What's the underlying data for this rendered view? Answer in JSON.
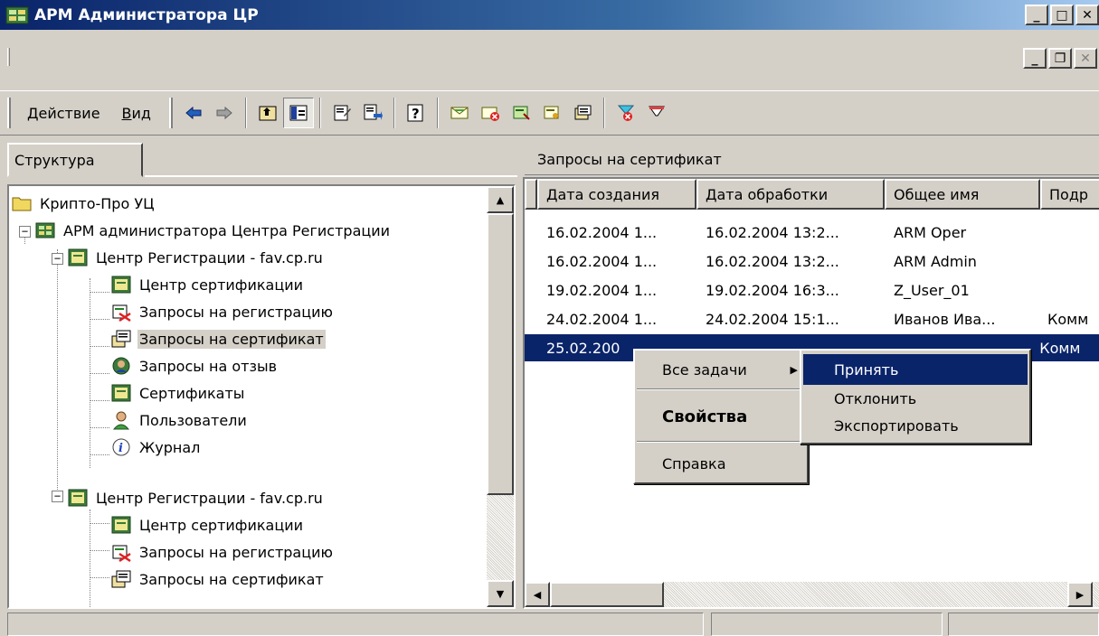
{
  "window": {
    "title": "АРМ Администратора ЦР"
  },
  "menu": {
    "action_label": "Действие",
    "action_underline": "Д",
    "action_rest": "ействие",
    "view_label": "Вид",
    "view_underline": "В",
    "view_rest": "ид"
  },
  "left_pane": {
    "tab_label": "Структура",
    "tree": [
      {
        "label": "Крипто-Про УЦ",
        "icon": "folder-icon"
      },
      {
        "label": "АРМ администратора Центра Регистрации",
        "icon": "app-icon"
      },
      {
        "label": "Центр Регистрации - fav.cp.ru",
        "icon": "registration-center-icon"
      },
      {
        "label": "Центр сертификации",
        "icon": "certification-center-icon"
      },
      {
        "label": "Запросы на регистрацию",
        "icon": "registration-requests-icon"
      },
      {
        "label": "Запросы на сертификат",
        "icon": "certificate-requests-icon"
      },
      {
        "label": "Запросы на отзыв",
        "icon": "revocation-requests-icon"
      },
      {
        "label": "Сертификаты",
        "icon": "certificates-icon"
      },
      {
        "label": "Пользователи",
        "icon": "users-icon"
      },
      {
        "label": "Журнал",
        "icon": "journal-icon"
      },
      {
        "label": "Центр Регистрации - fav.cp.ru",
        "icon": "registration-center-icon"
      },
      {
        "label": "Центр сертификации",
        "icon": "certification-center-icon"
      },
      {
        "label": "Запросы на регистрацию",
        "icon": "registration-requests-icon"
      },
      {
        "label": "Запросы на сертификат",
        "icon": "certificate-requests-icon"
      }
    ]
  },
  "right_pane": {
    "header": "Запросы на сертификат",
    "columns": [
      "Дата создания",
      "Дата обработки",
      "Общее имя",
      "Подр"
    ],
    "rows": [
      [
        "16.02.2004 1...",
        "16.02.2004 13:2...",
        "ARM Oper",
        ""
      ],
      [
        "16.02.2004 1...",
        "16.02.2004 13:2...",
        "ARM Admin",
        ""
      ],
      [
        "19.02.2004 1...",
        "19.02.2004 16:3...",
        "Z_User_01",
        ""
      ],
      [
        "24.02.2004 1...",
        "24.02.2004 15:1...",
        "Иванов Ива...",
        "Комм"
      ],
      [
        "25.02.200",
        "",
        "",
        "Комм"
      ]
    ]
  },
  "context_menu": {
    "all_tasks": "Все задачи",
    "properties": "Свойства",
    "help": "Справка"
  },
  "submenu": {
    "accept": "Принять",
    "reject": "Отклонить",
    "export": "Экспортировать"
  },
  "colors": {
    "selection": "#0a246a",
    "face": "#d4d0c8"
  }
}
